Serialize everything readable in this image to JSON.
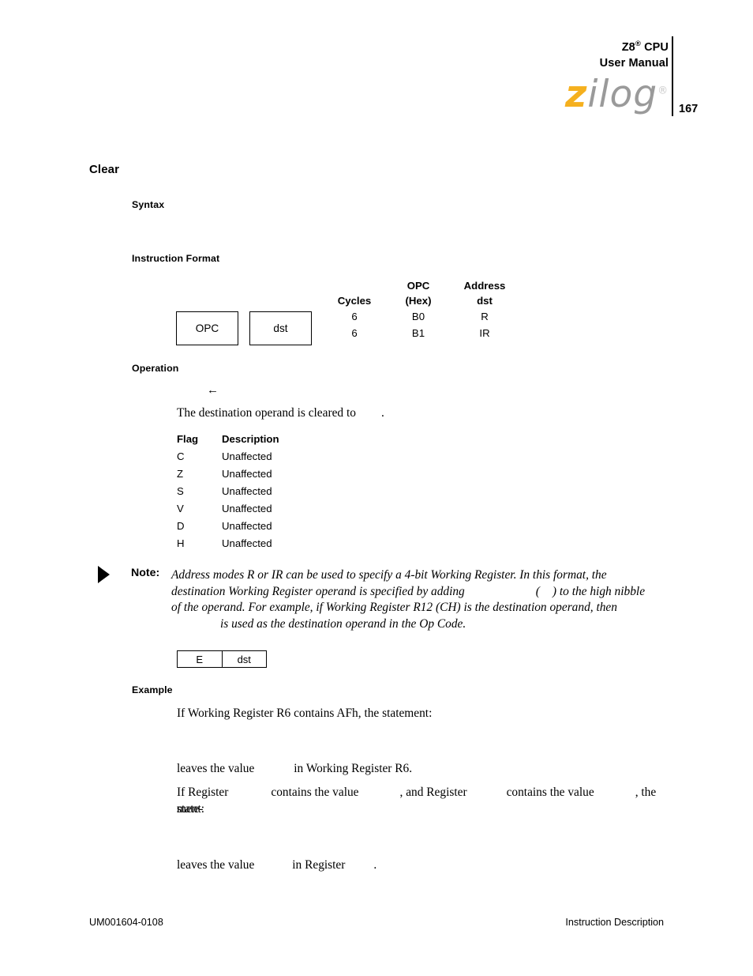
{
  "header": {
    "product_line1": "Z8",
    "product_reg": "®",
    "product_line1_tail": " CPU",
    "product_line2": "User Manual",
    "logo_z": "z",
    "logo_ilog": "ilog",
    "logo_reg": "®",
    "page_number": "167"
  },
  "page": {
    "title": "Clear"
  },
  "sections": {
    "syntax_heading": "Syntax",
    "instruction_format_heading": "Instruction Format",
    "operation_heading": "Operation",
    "example_heading": "Example"
  },
  "instruction_format": {
    "box_opc": "OPC",
    "box_dst": "dst",
    "columns": [
      "Cycles",
      "OPC\n(Hex)",
      "Address\ndst"
    ],
    "col_cycles": "Cycles",
    "col_opc_line1": "OPC",
    "col_opc_line2": "(Hex)",
    "col_addr_line1": "Address",
    "col_addr_line2": "dst",
    "rows": [
      {
        "cycles": "6",
        "opc": "B0",
        "addr": "R"
      },
      {
        "cycles": "6",
        "opc": "B1",
        "addr": "IR"
      }
    ]
  },
  "operation": {
    "arrow": "←",
    "description_before": "The destination operand is cleared to",
    "description_gap": "",
    "description_after": "."
  },
  "flags": {
    "header_flag": "Flag",
    "header_description": "Description",
    "rows": [
      {
        "flag": "C",
        "description": "Unaffected"
      },
      {
        "flag": "Z",
        "description": "Unaffected"
      },
      {
        "flag": "S",
        "description": "Unaffected"
      },
      {
        "flag": "V",
        "description": "Unaffected"
      },
      {
        "flag": "D",
        "description": "Unaffected"
      },
      {
        "flag": "H",
        "description": "Unaffected"
      }
    ]
  },
  "note": {
    "label": "Note:",
    "line1": "Address modes R or IR can be used to specify a 4-bit Working Register. In this format, the",
    "line2_a": "destination Working Register operand is specified by adding",
    "line2_gap": "",
    "line2_b": "(",
    "line2_gap2": "",
    "line2_c": ") to the high nibble",
    "line3": "of the operand. For example, if Working Register R12 (CH) is the destination operand, then",
    "line4_gap": "",
    "line4": "is used as the destination operand in the Op Code."
  },
  "opcode_box": {
    "high_nibble": "E",
    "low_nibble": "dst"
  },
  "example": {
    "line1": "If Working Register R6 contains AFh, the statement:",
    "code1": "",
    "line2_a": "leaves the value",
    "line2_gap": "",
    "line2_b": "in Working Register R6.",
    "line3_a": "If Register",
    "line3_gap1": "",
    "line3_b": "contains the value",
    "line3_gap2": "",
    "line3_c": ", and Register",
    "line3_gap3": "",
    "line3_d": "contains the value",
    "line3_gap4": "",
    "line3_e": ", the state-",
    "line3_f": "ment:",
    "code2": "",
    "line4_a": "leaves the value",
    "line4_gap": "",
    "line4_b": "in Register",
    "line4_gap2": "",
    "line4_c": "."
  },
  "footer": {
    "left": "UM001604-0108",
    "right": "Instruction Description"
  }
}
